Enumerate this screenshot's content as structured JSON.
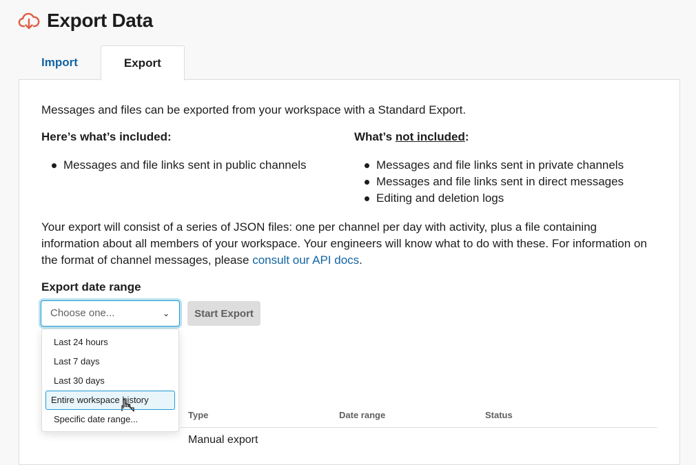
{
  "header": {
    "title": "Export Data",
    "icon": "cloud-download-icon",
    "icon_color": "#e05d44"
  },
  "tabs": [
    {
      "label": "Import",
      "active": false
    },
    {
      "label": "Export",
      "active": true
    }
  ],
  "intro": "Messages and files can be exported from your workspace with a Standard Export.",
  "included": {
    "heading": "Here’s what’s included:",
    "items": [
      "Messages and file links sent in public channels"
    ]
  },
  "not_included": {
    "heading_prefix": "What’s ",
    "heading_emph": "not included",
    "heading_suffix": ":",
    "items": [
      "Messages and file links sent in private channels",
      "Messages and file links sent in direct messages",
      "Editing and deletion logs"
    ]
  },
  "description": {
    "text": "Your export will consist of a series of JSON files: one per channel per day with activity, plus a file containing information about all members of your workspace. Your engineers will know what to do with these. For information on the format of channel messages, please ",
    "link": "consult our API docs",
    "suffix": "."
  },
  "date_range": {
    "label": "Export date range",
    "placeholder": "Choose one...",
    "options": [
      "Last 24 hours",
      "Last 7 days",
      "Last 30 days",
      "Entire workspace history",
      "Specific date range..."
    ],
    "highlighted": "Entire workspace history"
  },
  "start_button": "Start Export",
  "table": {
    "headers": [
      "Type",
      "Date range",
      "Status"
    ],
    "rows": [
      {
        "type": "Manual export"
      }
    ]
  },
  "colors": {
    "link": "#1264a3",
    "focus": "#1d9bd1",
    "text": "#1d1c1d"
  }
}
